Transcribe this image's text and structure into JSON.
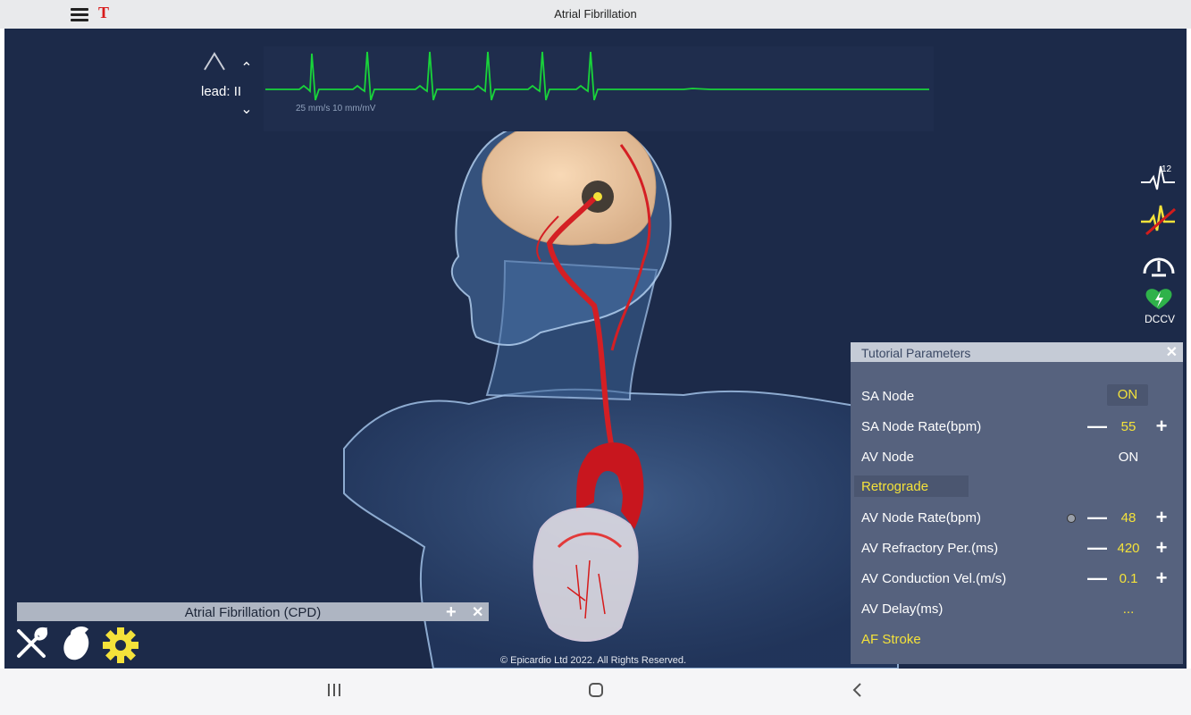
{
  "window": {
    "title": "Atrial Fibrillation"
  },
  "ecg": {
    "lead_label": "lead: II",
    "scale_text": "25 mm/s  10 mm/mV",
    "trace_color": "#19d43a"
  },
  "side_tools": {
    "dccv_label": "DCCV"
  },
  "tutorial": {
    "title": "Tutorial Parameters",
    "rows": [
      {
        "label": "SA Node",
        "value": "ON"
      },
      {
        "label": "SA Node Rate(bpm)",
        "value": "55"
      },
      {
        "label": "AV Node",
        "value": "ON"
      },
      {
        "label": "Retrograde"
      },
      {
        "label": "AV Node Rate(bpm)",
        "value": "48"
      },
      {
        "label": "AV Refractory Per.(ms)",
        "value": "420"
      },
      {
        "label": "AV Conduction Vel.(m/s)",
        "value": "0.1"
      },
      {
        "label": "AV Delay(ms)",
        "value": "..."
      },
      {
        "label": "AF Stroke"
      }
    ]
  },
  "case": {
    "title": "Atrial Fibrillation (CPD)"
  },
  "footer": {
    "copyright": "© Epicardio Ltd 2022. All Rights Reserved."
  },
  "colors": {
    "background": "#1c2a49",
    "accent_yellow": "#f4e23a",
    "panel": "#56627e"
  }
}
